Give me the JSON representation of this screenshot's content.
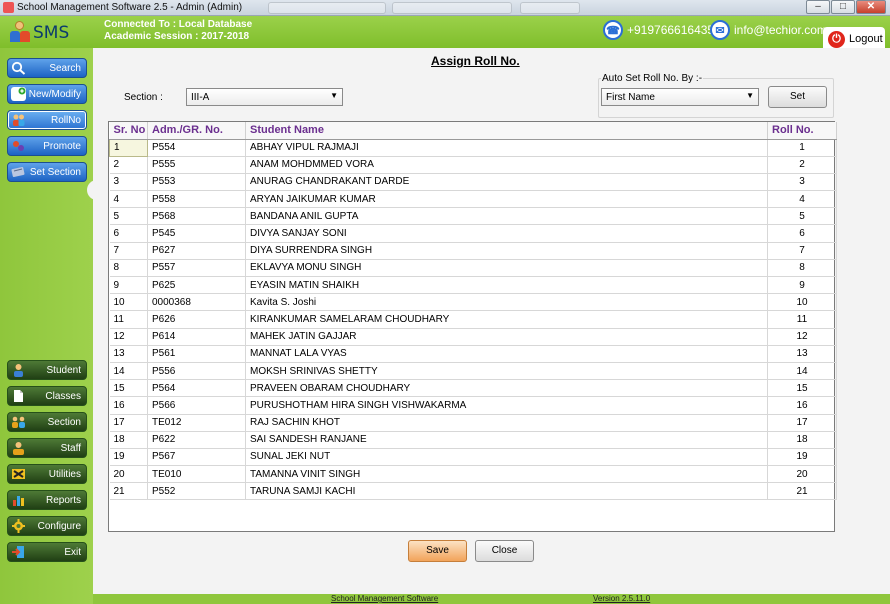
{
  "window": {
    "title": "School Management Software 2.5  -  Admin (Admin)"
  },
  "header": {
    "logo_text": "SMS",
    "connected_to": "Connected To : Local Database",
    "academic_session": "Academic Session : 2017-2018",
    "phone": "+919766616435",
    "email": "info@techior.com",
    "logout_label": "Logout"
  },
  "sidebar": {
    "top_buttons": [
      {
        "label": "Search",
        "icon": "magnifier-icon"
      },
      {
        "label": "New/Modify",
        "icon": "add-icon"
      },
      {
        "label": "RollNo",
        "icon": "people-icon"
      },
      {
        "label": "Promote",
        "icon": "promote-icon"
      },
      {
        "label": "Set Section",
        "icon": "section-icon"
      }
    ],
    "bottom_buttons": [
      {
        "label": "Student",
        "icon": "student-icon"
      },
      {
        "label": "Classes",
        "icon": "document-icon"
      },
      {
        "label": "Section",
        "icon": "group-icon"
      },
      {
        "label": "Staff",
        "icon": "staff-icon"
      },
      {
        "label": "Utilities",
        "icon": "tools-icon"
      },
      {
        "label": "Reports",
        "icon": "bar-chart-icon"
      },
      {
        "label": "Configure",
        "icon": "gear-icon"
      },
      {
        "label": "Exit",
        "icon": "exit-icon"
      }
    ]
  },
  "main": {
    "title": "Assign Roll No.",
    "section_label": "Section :",
    "section_value": "III-A",
    "autoset_label": "Auto Set Roll No. By :-",
    "autoset_value": "First Name",
    "set_button": "Set",
    "columns": [
      "Sr. No",
      "Adm./GR. No.",
      "Student Name",
      "Roll No."
    ],
    "rows": [
      {
        "sr": "1",
        "adm": "P554",
        "name": "ABHAY VIPUL RAJMAJI",
        "roll": "1"
      },
      {
        "sr": "2",
        "adm": "P555",
        "name": "ANAM MOHDMMED VORA",
        "roll": "2"
      },
      {
        "sr": "3",
        "adm": "P553",
        "name": "ANURAG CHANDRAKANT DARDE",
        "roll": "3"
      },
      {
        "sr": "4",
        "adm": "P558",
        "name": "ARYAN JAIKUMAR KUMAR",
        "roll": "4"
      },
      {
        "sr": "5",
        "adm": "P568",
        "name": "BANDANA ANIL GUPTA",
        "roll": "5"
      },
      {
        "sr": "6",
        "adm": "P545",
        "name": "DIVYA SANJAY SONI",
        "roll": "6"
      },
      {
        "sr": "7",
        "adm": "P627",
        "name": "DIYA SURRENDRA SINGH",
        "roll": "7"
      },
      {
        "sr": "8",
        "adm": "P557",
        "name": "EKLAVYA MONU SINGH",
        "roll": "8"
      },
      {
        "sr": "9",
        "adm": "P625",
        "name": "EYASIN MATIN SHAIKH",
        "roll": "9"
      },
      {
        "sr": "10",
        "adm": "0000368",
        "name": "Kavita S. Joshi",
        "roll": "10"
      },
      {
        "sr": "11",
        "adm": "P626",
        "name": "KIRANKUMAR SAMELARAM CHOUDHARY",
        "roll": "11"
      },
      {
        "sr": "12",
        "adm": "P614",
        "name": "MAHEK JATIN GAJJAR",
        "roll": "12"
      },
      {
        "sr": "13",
        "adm": "P561",
        "name": "MANNAT LALA VYAS",
        "roll": "13"
      },
      {
        "sr": "14",
        "adm": "P556",
        "name": "MOKSH SRINIVAS SHETTY",
        "roll": "14"
      },
      {
        "sr": "15",
        "adm": "P564",
        "name": "PRAVEEN OBARAM CHOUDHARY",
        "roll": "15"
      },
      {
        "sr": "16",
        "adm": "P566",
        "name": "PURUSHOTHAM HIRA SINGH VISHWAKARMA",
        "roll": "16"
      },
      {
        "sr": "17",
        "adm": "TE012",
        "name": "RAJ SACHIN KHOT",
        "roll": "17"
      },
      {
        "sr": "18",
        "adm": "P622",
        "name": "SAI SANDESH RANJANE",
        "roll": "18"
      },
      {
        "sr": "19",
        "adm": "P567",
        "name": "SUNAL JEKI NUT",
        "roll": "19"
      },
      {
        "sr": "20",
        "adm": "TE010",
        "name": "TAMANNA VINIT SINGH",
        "roll": "20"
      },
      {
        "sr": "21",
        "adm": "P552",
        "name": "TARUNA SAMJI KACHI",
        "roll": "21"
      }
    ],
    "save_button": "Save",
    "close_button": "Close"
  },
  "statusbar": {
    "app_name": "School Management Software",
    "version": "Version 2.5.11.0"
  },
  "colors": {
    "header_green": "#8fc63c",
    "nav_blue": "#1d63c4",
    "nav_dark_green": "#203f14",
    "column_header_purple": "#6b2f8f",
    "save_orange": "#f2a35a"
  }
}
